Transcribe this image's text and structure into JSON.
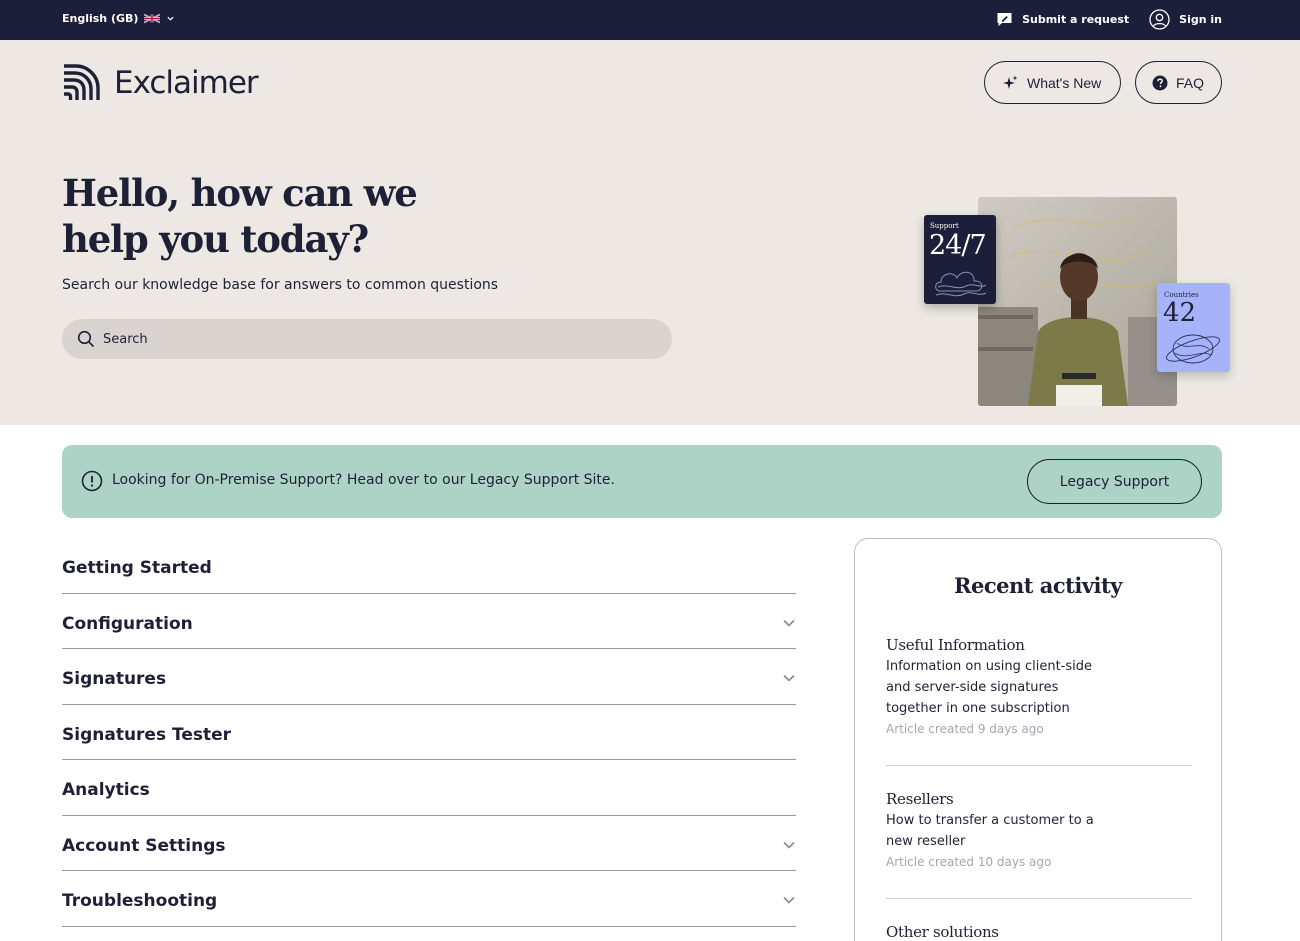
{
  "topbar": {
    "language": "English (GB)",
    "submit_request": "Submit a request",
    "sign_in": "Sign in"
  },
  "brand": {
    "name": "Exclaimer"
  },
  "header": {
    "whats_new": "What's New",
    "faq": "FAQ"
  },
  "hero": {
    "title": "Hello, how can we help you today?",
    "subtitle": "Search our knowledge base for answers to common questions",
    "search_placeholder": "Search",
    "support_card": {
      "label": "Support",
      "value": "24/7"
    },
    "countries_card": {
      "label": "Countries",
      "value": "42"
    }
  },
  "banner": {
    "text": "Looking for On-Premise Support? Head over to our Legacy Support Site.",
    "button": "Legacy Support"
  },
  "categories": [
    {
      "label": "Getting Started",
      "expandable": false
    },
    {
      "label": "Configuration",
      "expandable": true
    },
    {
      "label": "Signatures",
      "expandable": true
    },
    {
      "label": "Signatures Tester",
      "expandable": false
    },
    {
      "label": "Analytics",
      "expandable": false
    },
    {
      "label": "Account Settings",
      "expandable": true
    },
    {
      "label": "Troubleshooting",
      "expandable": true
    }
  ],
  "recent_activity": {
    "title": "Recent activity",
    "items": [
      {
        "category": "Useful Information",
        "title": "Information on using client-side and server-side signatures together in one subscription",
        "meta": "Article created 9 days ago"
      },
      {
        "category": "Resellers",
        "title": "How to transfer a customer to a new reseller",
        "meta": "Article created 10 days ago"
      },
      {
        "category": "Other solutions",
        "title": "",
        "meta": ""
      }
    ]
  },
  "colors": {
    "navy": "#1c1f3a",
    "hero_bg": "#ede8e3",
    "banner_bg": "#acd3c5",
    "countries_card": "#a6b3fb"
  }
}
